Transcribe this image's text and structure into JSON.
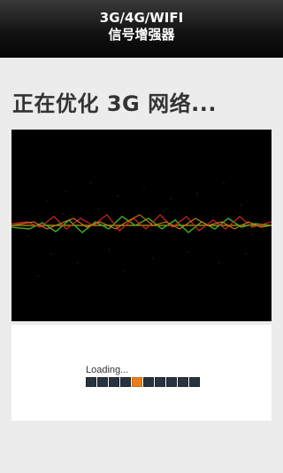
{
  "header": {
    "line1": "3G/4G/WIFI",
    "line2": "信号增强器"
  },
  "main": {
    "status_title": "正在优化 3G 网络..."
  },
  "loading": {
    "label": "Loading...",
    "segment_count": 10,
    "active_segment": 5,
    "accent_color": "#e97d1e",
    "segment_color": "#283340"
  },
  "colors": {
    "header_bg": "#1a1a1a",
    "page_bg": "#ececec",
    "viz_bg": "#000000"
  }
}
